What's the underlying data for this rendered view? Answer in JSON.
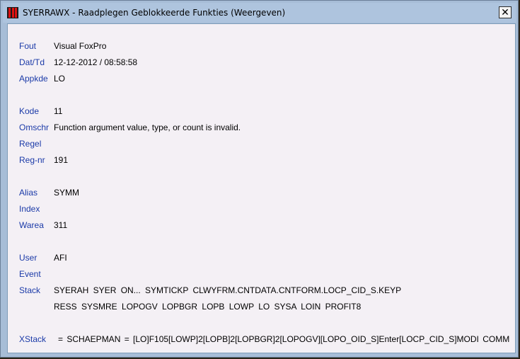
{
  "window": {
    "title": "SYERRAWX - Raadplegen Geblokkeerde Funkties (Weergeven)",
    "close_label": "✕"
  },
  "fields": {
    "fout": {
      "label": "Fout",
      "value": "Visual FoxPro"
    },
    "dattd": {
      "label": "Dat/Td",
      "value": "12-12-2012 / 08:58:58"
    },
    "appkde": {
      "label": "Appkde",
      "value": "LO"
    },
    "kode": {
      "label": "Kode",
      "value": "11"
    },
    "omschr": {
      "label": "Omschr",
      "value": "Function argument value, type, or count is invalid."
    },
    "regel": {
      "label": "Regel",
      "value": ""
    },
    "regnr": {
      "label": "Reg-nr",
      "value": "191"
    },
    "alias": {
      "label": "Alias",
      "value": "SYMM"
    },
    "index": {
      "label": "Index",
      "value": ""
    },
    "warea": {
      "label": "Warea",
      "value": "311"
    },
    "user": {
      "label": "User",
      "value": "AFI"
    },
    "event": {
      "label": "Event",
      "value": ""
    },
    "stack": {
      "label": "Stack",
      "line1": "SYERAH  SYER  ON...  SYMTICKP  CLWYFRM.CNTDATA.CNTFORM.LOCP_CID_S.KEYP",
      "line2": "RESS  SYSMRE  LOPOGV  LOPBGR  LOPB  LOWP  LO  SYSA  LOIN  PROFIT8"
    },
    "xstack": {
      "label": "XStack",
      "value": "=  SCHAEPMAN  =  [LO]F105[LOWP]2[LOPB]2[LOPBGR]2[LOPOGV][LOPO_OID_S]Enter[LOCP_CID_S]MODI COMM"
    }
  }
}
